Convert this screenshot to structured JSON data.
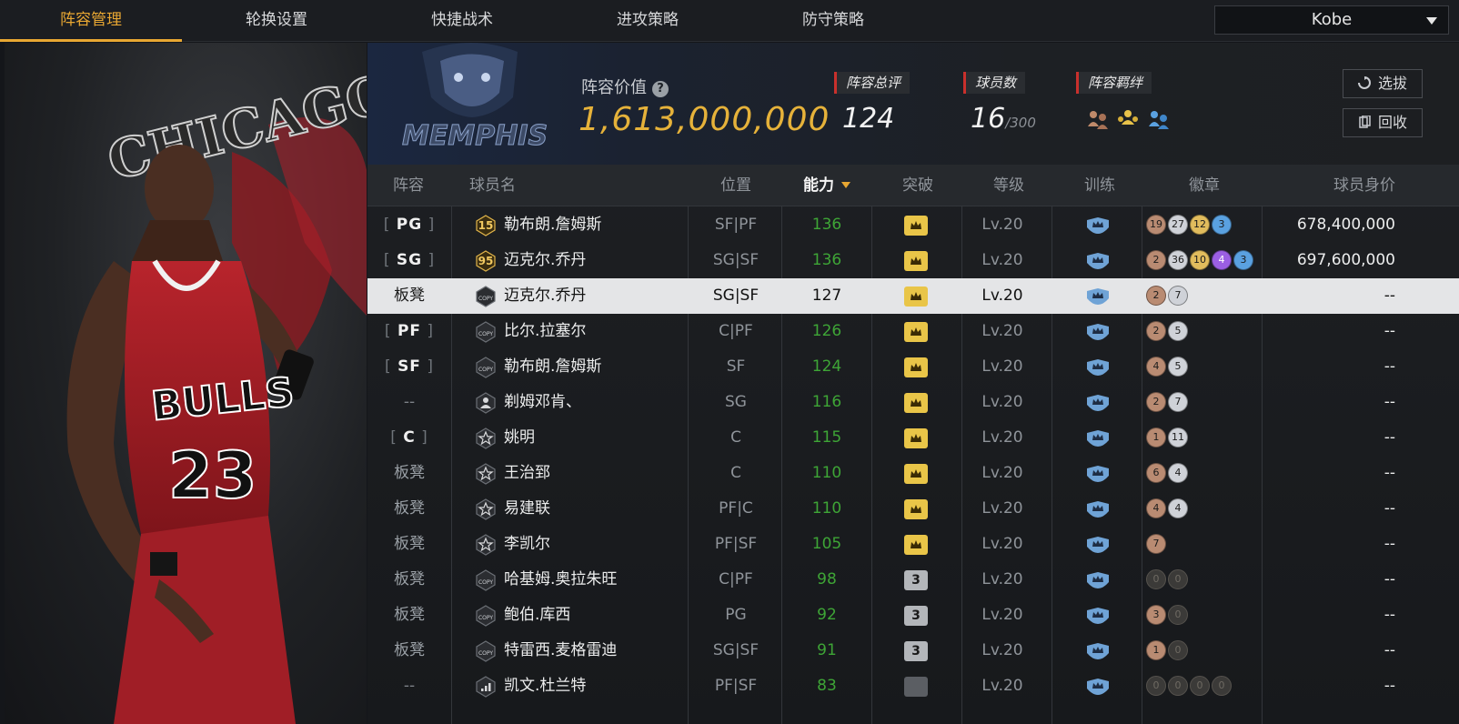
{
  "nav": {
    "tabs": [
      "阵容管理",
      "轮换设置",
      "快捷战术",
      "进攻策略",
      "防守策略"
    ],
    "active": 0,
    "account": "Kobe"
  },
  "summary": {
    "value_label": "阵容价值",
    "value": "1,613,000,000",
    "rating_label": "阵容总评",
    "rating": "124",
    "count_label": "球员数",
    "count": "16",
    "count_max": "/300",
    "bond_label": "阵容羁绊",
    "bond_icons": [
      "bond-bronze-icon",
      "bond-gold-icon",
      "bond-blue-icon"
    ],
    "select_button": "选拔",
    "recycle_button": "回收"
  },
  "table": {
    "headers": [
      "阵容",
      "球员名",
      "位置",
      "能力",
      "突破",
      "等级",
      "训练",
      "徽章",
      "球员身价"
    ],
    "sorted_column": "能力",
    "rows": [
      {
        "slot": "PG",
        "slot_type": "pos",
        "card": "15",
        "name": "勒布朗.詹姆斯",
        "pos": "SF|PF",
        "ovr": "136",
        "brk": "gold",
        "lv": "Lv.20",
        "badges": [
          [
            "19",
            "br"
          ],
          [
            "27",
            "si"
          ],
          [
            "12",
            "go"
          ],
          [
            "3",
            "bl"
          ]
        ],
        "price": "678,400,000"
      },
      {
        "slot": "SG",
        "slot_type": "pos",
        "card": "95",
        "name": "迈克尔.乔丹",
        "pos": "SG|SF",
        "ovr": "136",
        "brk": "gold",
        "lv": "Lv.20",
        "badges": [
          [
            "2",
            "br"
          ],
          [
            "36",
            "si"
          ],
          [
            "10",
            "go"
          ],
          [
            "4",
            "pu"
          ],
          [
            "3",
            "bl"
          ]
        ],
        "price": "697,600,000"
      },
      {
        "slot": "板凳",
        "slot_type": "bench",
        "card": "COPY",
        "name": "迈克尔.乔丹",
        "pos": "SG|SF",
        "ovr": "127",
        "brk": "gold",
        "lv": "Lv.20",
        "badges": [
          [
            "2",
            "br"
          ],
          [
            "7",
            "si"
          ]
        ],
        "price": "--",
        "selected": true
      },
      {
        "slot": "PF",
        "slot_type": "pos",
        "card": "COPY",
        "name": "比尔.拉塞尔",
        "pos": "C|PF",
        "ovr": "126",
        "brk": "gold",
        "lv": "Lv.20",
        "badges": [
          [
            "2",
            "br"
          ],
          [
            "5",
            "si"
          ]
        ],
        "price": "--"
      },
      {
        "slot": "SF",
        "slot_type": "pos",
        "card": "COPY",
        "name": "勒布朗.詹姆斯",
        "pos": "SF",
        "ovr": "124",
        "brk": "gold",
        "lv": "Lv.20",
        "badges": [
          [
            "4",
            "br"
          ],
          [
            "5",
            "si"
          ]
        ],
        "price": "--"
      },
      {
        "slot": "--",
        "slot_type": "dash",
        "card": "person",
        "name": "剃姆邓肯、",
        "pos": "SG",
        "ovr": "116",
        "brk": "gold",
        "lv": "Lv.20",
        "badges": [
          [
            "2",
            "br"
          ],
          [
            "7",
            "si"
          ]
        ],
        "price": "--"
      },
      {
        "slot": "C",
        "slot_type": "pos",
        "card": "star",
        "name": "姚明",
        "pos": "C",
        "ovr": "115",
        "brk": "gold",
        "lv": "Lv.20",
        "badges": [
          [
            "1",
            "br"
          ],
          [
            "11",
            "si"
          ]
        ],
        "price": "--"
      },
      {
        "slot": "板凳",
        "slot_type": "bench",
        "card": "star",
        "name": "王治郅",
        "pos": "C",
        "ovr": "110",
        "brk": "gold",
        "lv": "Lv.20",
        "badges": [
          [
            "6",
            "br"
          ],
          [
            "4",
            "si"
          ]
        ],
        "price": "--"
      },
      {
        "slot": "板凳",
        "slot_type": "bench",
        "card": "star",
        "name": "易建联",
        "pos": "PF|C",
        "ovr": "110",
        "brk": "gold",
        "lv": "Lv.20",
        "badges": [
          [
            "4",
            "br"
          ],
          [
            "4",
            "si"
          ]
        ],
        "price": "--"
      },
      {
        "slot": "板凳",
        "slot_type": "bench",
        "card": "star",
        "name": "李凯尔",
        "pos": "PF|SF",
        "ovr": "105",
        "brk": "gold",
        "lv": "Lv.20",
        "badges": [
          [
            "7",
            "br"
          ]
        ],
        "price": "--"
      },
      {
        "slot": "板凳",
        "slot_type": "bench",
        "card": "COPY",
        "name": "哈基姆.奥拉朱旺",
        "pos": "C|PF",
        "ovr": "98",
        "brk": "3",
        "lv": "Lv.20",
        "badges": [
          [
            "0",
            "x"
          ],
          [
            "0",
            "x"
          ]
        ],
        "price": "--"
      },
      {
        "slot": "板凳",
        "slot_type": "bench",
        "card": "COPY",
        "name": "鲍伯.库西",
        "pos": "PG",
        "ovr": "92",
        "brk": "3",
        "lv": "Lv.20",
        "badges": [
          [
            "3",
            "br"
          ],
          [
            "0",
            "x"
          ]
        ],
        "price": "--"
      },
      {
        "slot": "板凳",
        "slot_type": "bench",
        "card": "COPY",
        "name": "特雷西.麦格雷迪",
        "pos": "SG|SF",
        "ovr": "91",
        "brk": "3",
        "lv": "Lv.20",
        "badges": [
          [
            "1",
            "br"
          ],
          [
            "0",
            "x"
          ]
        ],
        "price": "--"
      },
      {
        "slot": "--",
        "slot_type": "dash",
        "card": "bars",
        "name": "凯文.杜兰特",
        "pos": "PF|SF",
        "ovr": "83",
        "brk": "dim",
        "lv": "Lv.20",
        "badges": [
          [
            "0",
            "x"
          ],
          [
            "0",
            "x"
          ],
          [
            "0",
            "x"
          ],
          [
            "0",
            "x"
          ]
        ],
        "price": "--"
      }
    ]
  },
  "hero": {
    "team_text": "CHICAGO BULLS",
    "jersey_text": "BULLS",
    "jersey_number": "23",
    "team_logo_text": "MEMPHIS"
  },
  "colors": {
    "accent": "#e8a732",
    "rating_green": "#3ea536",
    "value_gold": "#e6b23a",
    "label_red": "#c9302c"
  }
}
